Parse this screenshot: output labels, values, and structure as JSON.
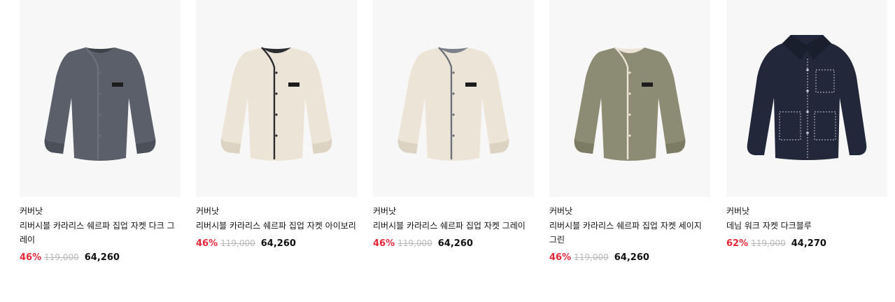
{
  "colors": {
    "discount": "#e6283a",
    "original_price": "#b8b8b8",
    "thumb_bg": "#f7f7f7"
  },
  "products": [
    {
      "brand": "커버낫",
      "name": "리버시블 카라리스 쉐르파 집업 자켓 다크 그레이",
      "discount": "46%",
      "original_price": "119,000",
      "sale_price": "64,260",
      "image": {
        "icon": "collarless-jacket-icon",
        "body": "#5a5f69",
        "shade": "#4b5059",
        "trim": "#6a6f78",
        "inner": "#3d4148"
      }
    },
    {
      "brand": "커버낫",
      "name": "리버시블 카라리스 쉐르파 집업 자켓 아이보리",
      "discount": "46%",
      "original_price": "119,000",
      "sale_price": "64,260",
      "image": {
        "icon": "collarless-jacket-icon",
        "body": "#ece4d6",
        "shade": "#ddd3c2",
        "trim": "#2b2d31",
        "inner": "#2b2d31"
      }
    },
    {
      "brand": "커버낫",
      "name": "리버시블 카라리스 쉐르파 집업 자켓 그레이",
      "discount": "46%",
      "original_price": "119,000",
      "sale_price": "64,260",
      "image": {
        "icon": "collarless-jacket-icon",
        "body": "#ece4d6",
        "shade": "#ddd3c2",
        "trim": "#6e737b",
        "inner": "#7c8088"
      }
    },
    {
      "brand": "커버낫",
      "name": "리버시블 카라리스 쉐르파 집업 자켓 세이지 그린",
      "discount": "46%",
      "original_price": "119,000",
      "sale_price": "64,260",
      "image": {
        "icon": "collarless-jacket-icon",
        "body": "#8c8b73",
        "shade": "#7c7b64",
        "trim": "#ece4d6",
        "inner": "#ece4d6"
      }
    },
    {
      "brand": "커버낫",
      "name": "데님 워크 자켓 다크블루",
      "discount": "62%",
      "original_price": "119,000",
      "sale_price": "44,270",
      "image": {
        "icon": "denim-work-jacket-icon",
        "body": "#22283a",
        "shade": "#1a1f2e",
        "trim": "#c9ccd4",
        "inner": "#141824"
      }
    }
  ]
}
